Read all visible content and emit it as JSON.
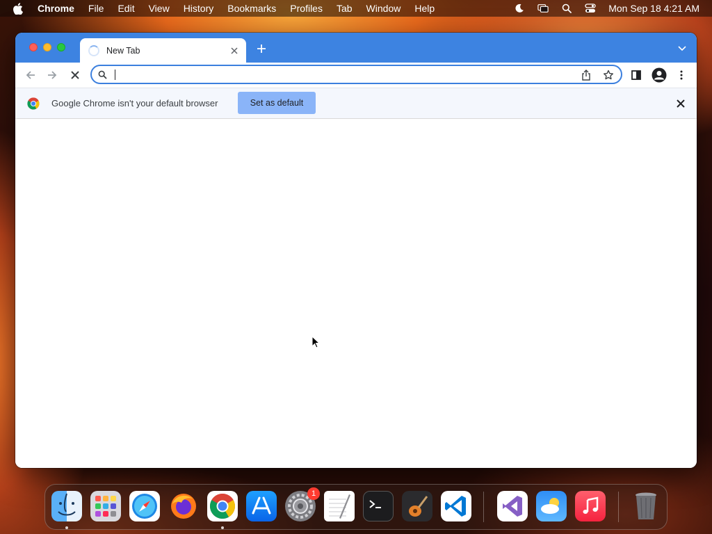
{
  "menubar": {
    "apple_icon": "apple-logo-icon",
    "items": [
      "Chrome",
      "File",
      "Edit",
      "View",
      "History",
      "Bookmarks",
      "Profiles",
      "Tab",
      "Window",
      "Help"
    ],
    "status_icons": [
      "focus-moon-icon",
      "screen-mirroring-icon",
      "spotlight-search-icon",
      "control-center-icon"
    ],
    "clock": "Mon Sep 18  4:21 AM"
  },
  "browser": {
    "tab": {
      "title": "New Tab",
      "loading": true
    },
    "omnibox": {
      "value": "",
      "placeholder": ""
    },
    "infobar": {
      "message": "Google Chrome isn't your default browser",
      "button_label": "Set as default"
    },
    "colors": {
      "tabstrip": "#3d83e1",
      "accent": "#3b7fde",
      "button": "#8ab4f8"
    }
  },
  "dock": {
    "apps": [
      "Finder",
      "Launchpad",
      "Safari",
      "Firefox",
      "Google Chrome",
      "App Store",
      "System Settings",
      "TextEdit",
      "Terminal",
      "GarageBand",
      "Visual Studio Code",
      "Visual Studio",
      "Weather",
      "Music",
      "Trash"
    ],
    "running": [
      "Finder",
      "Google Chrome"
    ],
    "badges": {
      "System Settings": "1"
    }
  }
}
